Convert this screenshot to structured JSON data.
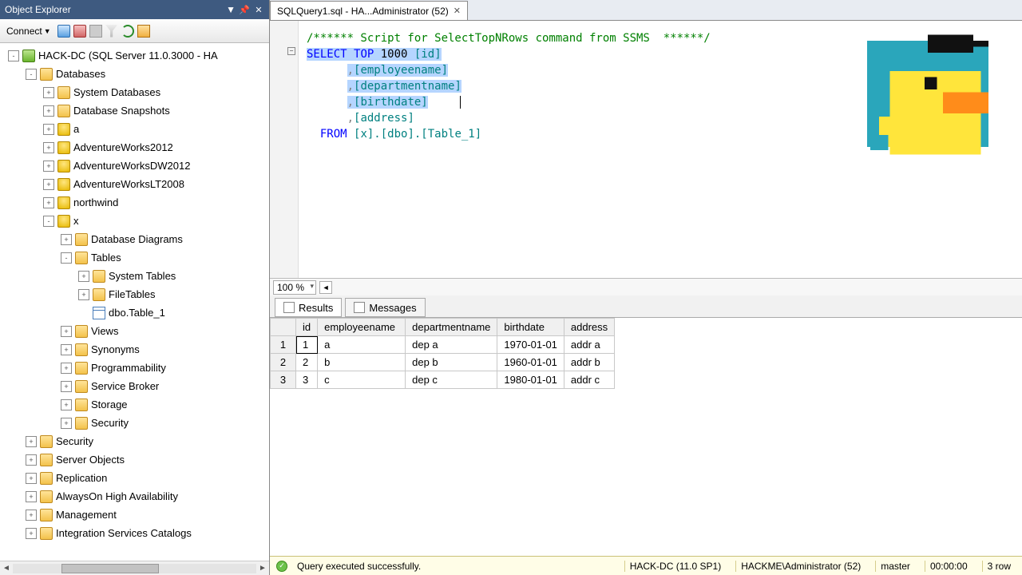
{
  "objectExplorer": {
    "title": "Object Explorer",
    "connectLabel": "Connect",
    "tree": [
      {
        "depth": 0,
        "exp": "-",
        "icon": "server",
        "label": "HACK-DC (SQL Server 11.0.3000 - HA"
      },
      {
        "depth": 1,
        "exp": "-",
        "icon": "folder",
        "label": "Databases"
      },
      {
        "depth": 2,
        "exp": "+",
        "icon": "folder",
        "label": "System Databases"
      },
      {
        "depth": 2,
        "exp": "+",
        "icon": "folder",
        "label": "Database Snapshots"
      },
      {
        "depth": 2,
        "exp": "+",
        "icon": "db",
        "label": "a"
      },
      {
        "depth": 2,
        "exp": "+",
        "icon": "db",
        "label": "AdventureWorks2012"
      },
      {
        "depth": 2,
        "exp": "+",
        "icon": "db",
        "label": "AdventureWorksDW2012"
      },
      {
        "depth": 2,
        "exp": "+",
        "icon": "db",
        "label": "AdventureWorksLT2008"
      },
      {
        "depth": 2,
        "exp": "+",
        "icon": "db",
        "label": "northwind"
      },
      {
        "depth": 2,
        "exp": "-",
        "icon": "db",
        "label": "x"
      },
      {
        "depth": 3,
        "exp": "+",
        "icon": "folder",
        "label": "Database Diagrams"
      },
      {
        "depth": 3,
        "exp": "-",
        "icon": "folder",
        "label": "Tables"
      },
      {
        "depth": 4,
        "exp": "+",
        "icon": "folder",
        "label": "System Tables"
      },
      {
        "depth": 4,
        "exp": "+",
        "icon": "folder",
        "label": "FileTables"
      },
      {
        "depth": 4,
        "exp": " ",
        "icon": "table",
        "label": "dbo.Table_1"
      },
      {
        "depth": 3,
        "exp": "+",
        "icon": "folder",
        "label": "Views"
      },
      {
        "depth": 3,
        "exp": "+",
        "icon": "folder",
        "label": "Synonyms"
      },
      {
        "depth": 3,
        "exp": "+",
        "icon": "folder",
        "label": "Programmability"
      },
      {
        "depth": 3,
        "exp": "+",
        "icon": "folder",
        "label": "Service Broker"
      },
      {
        "depth": 3,
        "exp": "+",
        "icon": "folder",
        "label": "Storage"
      },
      {
        "depth": 3,
        "exp": "+",
        "icon": "folder",
        "label": "Security"
      },
      {
        "depth": 1,
        "exp": "+",
        "icon": "folder",
        "label": "Security"
      },
      {
        "depth": 1,
        "exp": "+",
        "icon": "folder",
        "label": "Server Objects"
      },
      {
        "depth": 1,
        "exp": "+",
        "icon": "folder",
        "label": "Replication"
      },
      {
        "depth": 1,
        "exp": "+",
        "icon": "folder",
        "label": "AlwaysOn High Availability"
      },
      {
        "depth": 1,
        "exp": "+",
        "icon": "folder",
        "label": "Management"
      },
      {
        "depth": 1,
        "exp": "+",
        "icon": "folder",
        "label": "Integration Services Catalogs"
      }
    ]
  },
  "tab": {
    "title": "SQLQuery1.sql - HA...Administrator (52)"
  },
  "editor": {
    "comment": "/****** Script for SelectTopNRows command from SSMS  ******/",
    "select": "SELECT",
    "top": "TOP",
    "topN": "1000",
    "cols": [
      "[id]",
      "[employeename]",
      "[departmentname]",
      "[birthdate]",
      "[address]"
    ],
    "from": "FROM",
    "fromTarget": "[x].[dbo].[Table_1]",
    "zoom": "100 %"
  },
  "resultTabs": {
    "results": "Results",
    "messages": "Messages"
  },
  "grid": {
    "headers": [
      "id",
      "employeename",
      "departmentname",
      "birthdate",
      "address"
    ],
    "rows": [
      [
        "1",
        "a",
        "dep a",
        "1970-01-01",
        "addr a"
      ],
      [
        "2",
        "b",
        "dep b",
        "1960-01-01",
        "addr b"
      ],
      [
        "3",
        "c",
        "dep c",
        "1980-01-01",
        "addr c"
      ]
    ]
  },
  "status": {
    "msg": "Query executed successfully.",
    "server": "HACK-DC (11.0 SP1)",
    "user": "HACKME\\Administrator (52)",
    "db": "master",
    "time": "00:00:00",
    "rows": "3 row"
  }
}
